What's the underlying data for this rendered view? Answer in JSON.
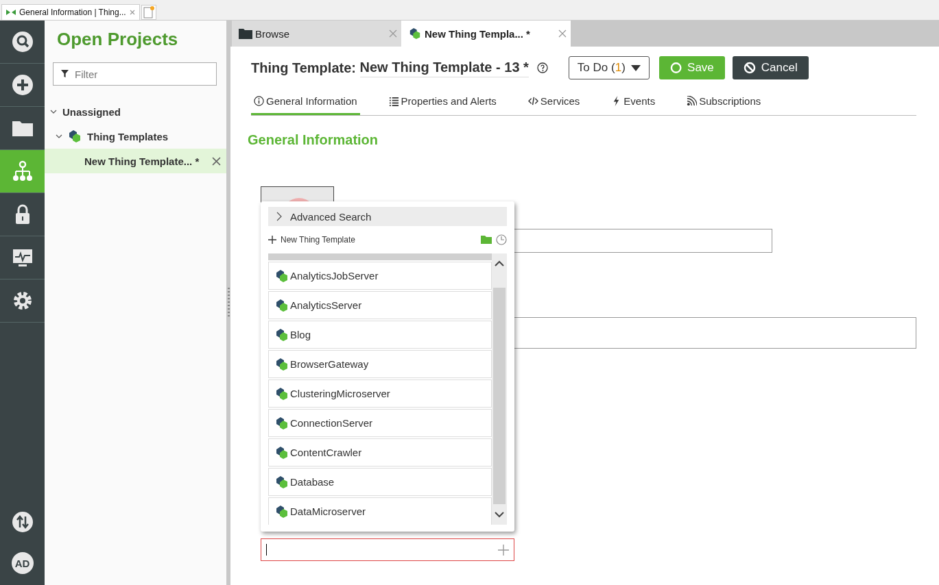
{
  "browser_tab": {
    "title": "General Information | Thing..."
  },
  "sidebar": {
    "items": [
      {
        "kind": "search",
        "selected": false
      },
      {
        "kind": "plus",
        "selected": false
      },
      {
        "kind": "folder",
        "selected": false
      },
      {
        "kind": "tree",
        "selected": true
      },
      {
        "kind": "lock",
        "selected": false
      },
      {
        "kind": "monitor",
        "selected": false
      },
      {
        "kind": "gear",
        "selected": false
      }
    ],
    "bottom": {
      "avatar": "AD"
    }
  },
  "projects": {
    "title": "Open Projects",
    "filter": {
      "placeholder": "Filter"
    },
    "tree": [
      {
        "label": "Unassigned",
        "expanded": true,
        "children": [
          {
            "label": "Thing Templates",
            "expanded": true,
            "icon": true,
            "children": [
              {
                "label": "New Thing Template... *",
                "selected": true
              }
            ]
          }
        ]
      }
    ]
  },
  "editor_tabs": [
    {
      "label": "Browse",
      "kind": "folder",
      "selected": false
    },
    {
      "label": "New Thing Templa...  *",
      "kind": "template",
      "selected": true
    }
  ],
  "header": {
    "title": "Thing Template: ",
    "name": "New Thing Template - 13 *",
    "todo": {
      "label": "To Do (",
      "count": "1",
      "close": ")"
    },
    "save": "Save",
    "cancel": "Cancel"
  },
  "nav_tabs": [
    {
      "label": "General Information",
      "kind": "info",
      "selected": true
    },
    {
      "label": "Properties and Alerts",
      "kind": "list",
      "selected": false
    },
    {
      "label": "Services",
      "kind": "code",
      "selected": false
    },
    {
      "label": "Events",
      "kind": "bolt",
      "selected": false
    },
    {
      "label": "Subscriptions",
      "kind": "rss",
      "selected": false
    }
  ],
  "section": {
    "title": "General Information"
  },
  "dropdown": {
    "advanced": "Advanced Search",
    "new_item": "New Thing Template",
    "items": [
      "AnalyticsJobServer",
      "AnalyticsServer",
      "Blog",
      "BrowserGateway",
      "ClusteringMicroserver",
      "ConnectionServer",
      "ContentCrawler",
      "Database",
      "DataMicroserver"
    ]
  }
}
